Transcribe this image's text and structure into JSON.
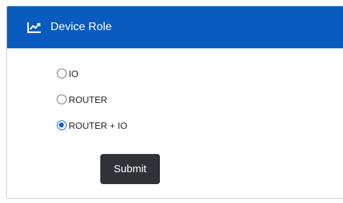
{
  "card": {
    "title": "Device Role",
    "icon": "line-chart-icon",
    "header_color": "#0a5bbf"
  },
  "role_options": [
    {
      "label": "IO",
      "checked": false
    },
    {
      "label": "ROUTER",
      "checked": false
    },
    {
      "label": "ROUTER + IO",
      "checked": true
    }
  ],
  "submit_label": "Submit",
  "colors": {
    "accent": "#0a64d8",
    "button_bg": "#2e3338"
  }
}
